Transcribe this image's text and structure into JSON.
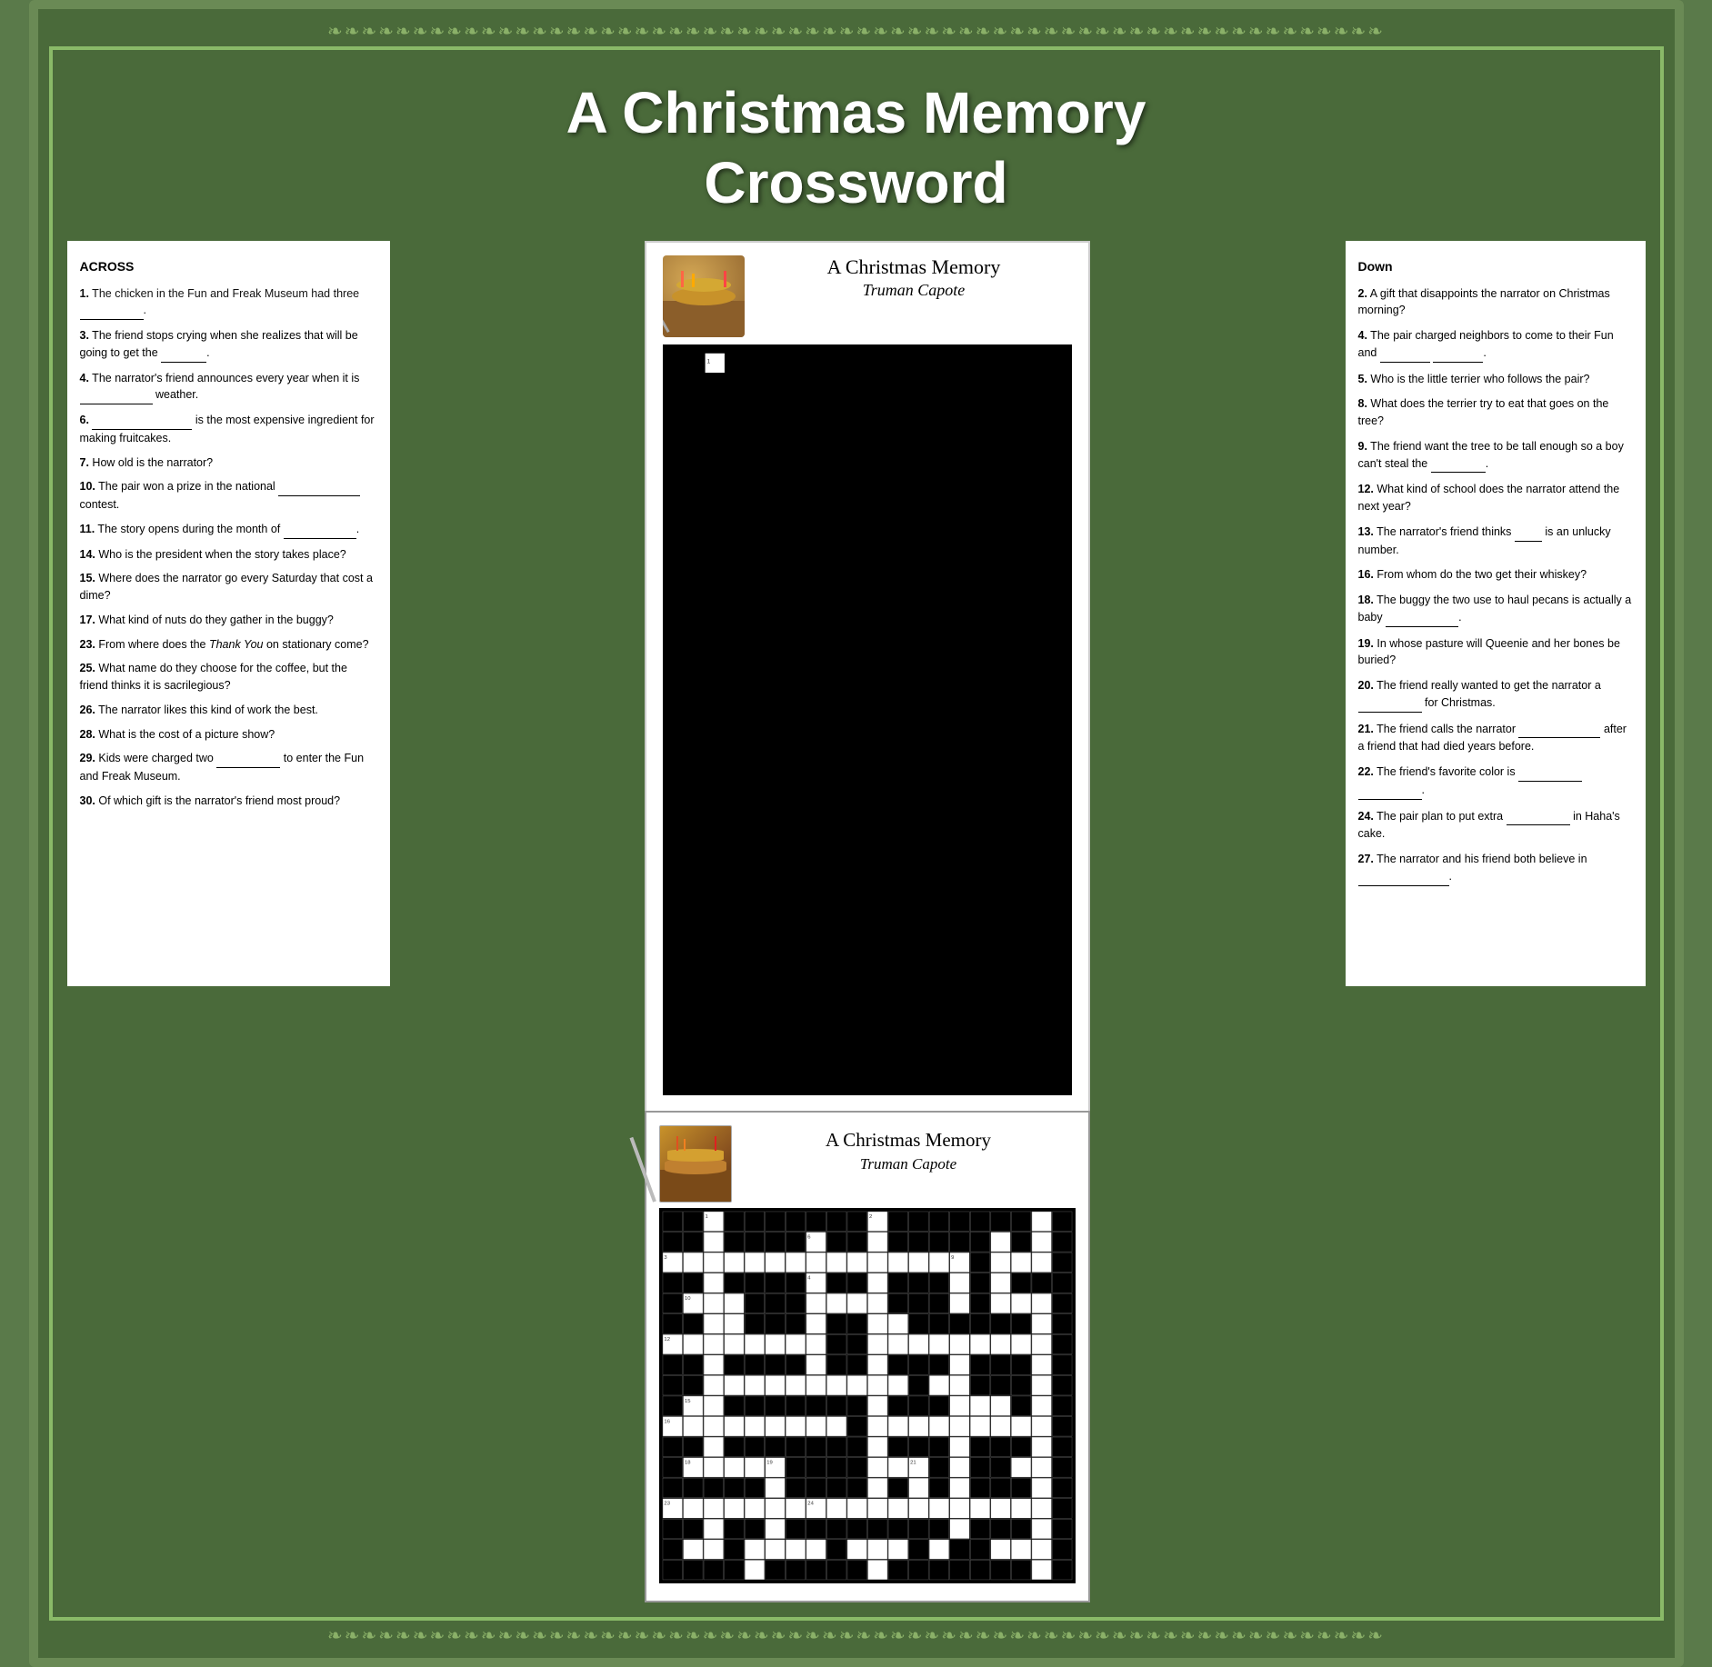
{
  "title": "A Christmas Memory Crossword",
  "title_line1": "A Christmas Memory",
  "title_line2": "Crossword",
  "book_title": "A Christmas Memory",
  "book_author": "Truman Capote",
  "across": {
    "heading": "ACROSS",
    "clues": [
      {
        "num": "1.",
        "text": "The chicken in the Fun and Freak Museum had three ___________.",
        "blank": true
      },
      {
        "num": "3.",
        "text": "The friend stops crying when she realizes that will be going to get the _________.",
        "blank": true
      },
      {
        "num": "4.",
        "text": "The narrator's friend announces every year when it is ___________ weather.",
        "blank": true
      },
      {
        "num": "6.",
        "text": "___________________ is the most expensive ingredient for making fruitcakes.",
        "blank": true
      },
      {
        "num": "7.",
        "text": "How old is the narrator?",
        "blank": false
      },
      {
        "num": "10.",
        "text": "The pair won a prize in the national ___________________ contest.",
        "blank": true
      },
      {
        "num": "11.",
        "text": "The story opens during the month of _______________.",
        "blank": true
      },
      {
        "num": "14.",
        "text": "Who is the president when the story takes place?",
        "blank": false
      },
      {
        "num": "15.",
        "text": "Where does the narrator go every Saturday that cost a dime?",
        "blank": false
      },
      {
        "num": "17.",
        "text": "What kind of nuts do they gather in the buggy?",
        "blank": false
      },
      {
        "num": "23.",
        "text": "From where does the Thank You on stationary come?",
        "blank": false
      },
      {
        "num": "25.",
        "text": "What name do they choose for the coffee, but the friend thinks it is sacrilegious?",
        "blank": false
      },
      {
        "num": "26.",
        "text": "The narrator likes this kind of work the best.",
        "blank": false
      },
      {
        "num": "28.",
        "text": "What is the cost of a picture show?",
        "blank": false
      },
      {
        "num": "29.",
        "text": "Kids were charged two ___________ to enter the Fun and Freak Museum.",
        "blank": true
      },
      {
        "num": "30.",
        "text": "Of which gift is the narrator's friend most proud?",
        "blank": false
      }
    ]
  },
  "down": {
    "heading": "Down",
    "clues": [
      {
        "num": "2.",
        "text": "A gift that disappoints the narrator on Christmas morning?"
      },
      {
        "num": "4.",
        "text": "The pair charged neighbors to come to their Fun and ___________ ___________."
      },
      {
        "num": "5.",
        "text": "Who is the little terrier who follows the pair?"
      },
      {
        "num": "8.",
        "text": "What does the terrier try to eat that goes on the tree?"
      },
      {
        "num": "9.",
        "text": "The friend want the tree to be tall enough so a boy can't steal the ___________."
      },
      {
        "num": "12.",
        "text": "What kind of school does the narrator attend the next year?"
      },
      {
        "num": "13.",
        "text": "The narrator's friend thinks ___ is an unlucky number."
      },
      {
        "num": "16.",
        "text": "From whom do the two get their whiskey?"
      },
      {
        "num": "18.",
        "text": "The buggy the two use to haul pecans is actually a baby ___________."
      },
      {
        "num": "19.",
        "text": "In whose pasture will Queenie and her bones be buried?"
      },
      {
        "num": "20.",
        "text": "The friend really wanted to get the narrator a ___________ for Christmas."
      },
      {
        "num": "21.",
        "text": "The friend calls the narrator ___________ after a friend that had died years before."
      },
      {
        "num": "22.",
        "text": "The friend's favorite color is ___________ ___________."
      },
      {
        "num": "24.",
        "text": "The pair plan to put extra ___________ in Haha's cake."
      },
      {
        "num": "27.",
        "text": "The narrator and his friend both believe in _______________."
      }
    ]
  }
}
